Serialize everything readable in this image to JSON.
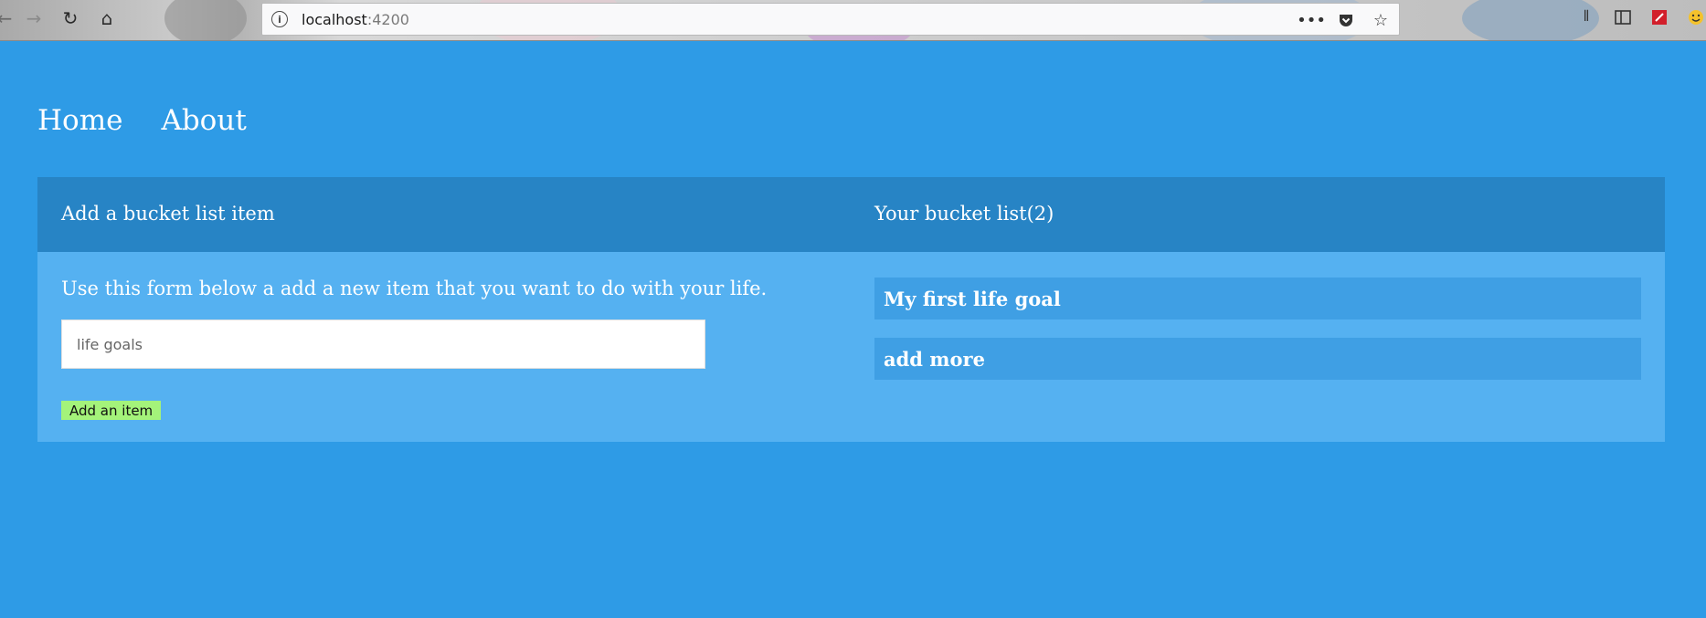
{
  "browser": {
    "url_host": "localhost",
    "url_port": ":4200",
    "nav": {
      "back": "←",
      "forward": "→",
      "reload": "↻",
      "home": "⌂"
    },
    "icons": [
      "info-icon",
      "more-icon",
      "pocket-icon",
      "bookmark-star-icon",
      "library-icon",
      "sidebar-icon",
      "extension-icon",
      "emoji-icon"
    ]
  },
  "page_nav": {
    "home": "Home",
    "about": "About"
  },
  "add_section": {
    "heading": "Add a bucket list item",
    "description": "Use this form below a add a new item that you want to do with your life.",
    "input_placeholder": "life goals",
    "input_value": "",
    "button_label": "Add an item"
  },
  "list_section": {
    "heading": "Your bucket list(2)",
    "items": [
      "My first life goal",
      "add more"
    ]
  },
  "colors": {
    "background": "#2e9be6",
    "panel": "#55b1f1",
    "panel_header": "#2784c5",
    "list_item": "#3f9fe4",
    "button": "#a4f37a"
  }
}
